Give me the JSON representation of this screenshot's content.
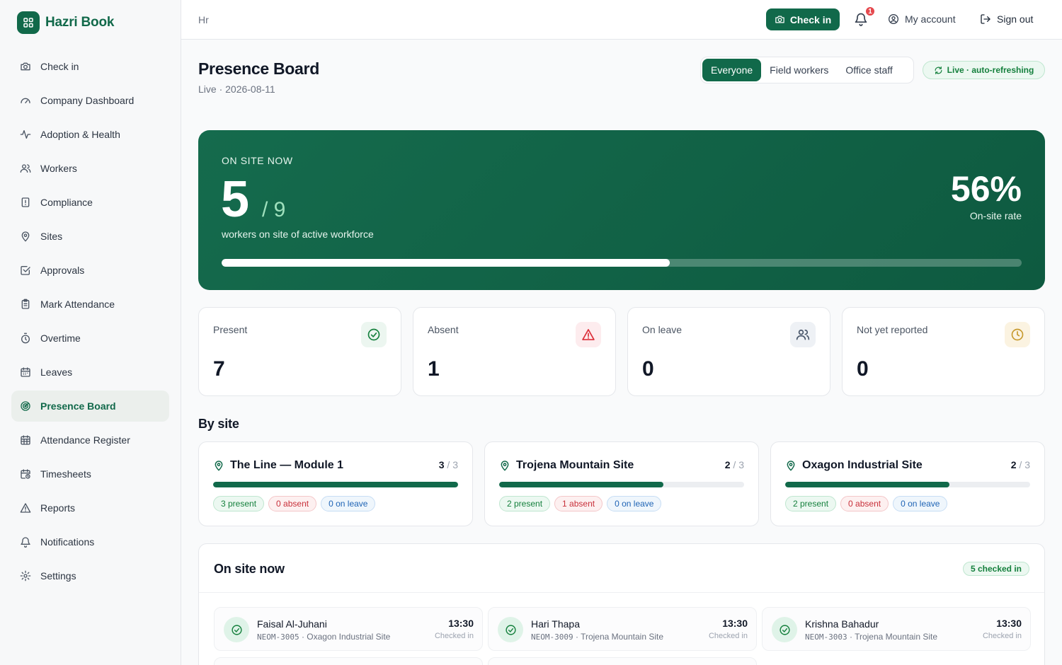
{
  "brand": {
    "name": "Hazri Book"
  },
  "sidebar": {
    "items": [
      {
        "label": "Check in",
        "icon": "camera-icon"
      },
      {
        "label": "Company Dashboard",
        "icon": "gauge-icon"
      },
      {
        "label": "Adoption & Health",
        "icon": "activity-icon"
      },
      {
        "label": "Workers",
        "icon": "users-icon"
      },
      {
        "label": "Compliance",
        "icon": "file-alert-icon"
      },
      {
        "label": "Sites",
        "icon": "map-pin-icon"
      },
      {
        "label": "Approvals",
        "icon": "check-square-icon"
      },
      {
        "label": "Mark Attendance",
        "icon": "clipboard-icon"
      },
      {
        "label": "Overtime",
        "icon": "timer-icon"
      },
      {
        "label": "Leaves",
        "icon": "calendar-icon"
      },
      {
        "label": "Presence Board",
        "icon": "radar-icon",
        "active": true
      },
      {
        "label": "Attendance Register",
        "icon": "calendar-grid-icon"
      },
      {
        "label": "Timesheets",
        "icon": "calendar-clock-icon"
      },
      {
        "label": "Reports",
        "icon": "triangle-alert-icon"
      },
      {
        "label": "Notifications",
        "icon": "bell-icon"
      },
      {
        "label": "Settings",
        "icon": "gear-icon"
      }
    ]
  },
  "topbar": {
    "breadcrumb": "Hr",
    "checkin_label": "Check in",
    "notification_count": "1",
    "account_label": "My account",
    "signout_label": "Sign out"
  },
  "header": {
    "title": "Presence Board",
    "subtitle": "Live · 2026-08-11",
    "filters": [
      "Everyone",
      "Field workers",
      "Office staff"
    ],
    "active_filter": "Everyone",
    "live_label": "Live · auto-refreshing"
  },
  "hero": {
    "label": "ON SITE NOW",
    "on_site": "5",
    "total": "/ 9",
    "caption": "workers on site of active workforce",
    "rate": "56%",
    "rate_label": "On-site rate",
    "progress": 0.56
  },
  "stats": [
    {
      "label": "Present",
      "value": "7",
      "icon": "check-circle-icon",
      "color": "#15803d",
      "bg": "#ecf6f0"
    },
    {
      "label": "Absent",
      "value": "1",
      "icon": "alert-triangle-icon",
      "color": "#dc2f3a",
      "bg": "#fdecee"
    },
    {
      "label": "On leave",
      "value": "0",
      "icon": "users-icon",
      "color": "#475569",
      "bg": "#eef1f5"
    },
    {
      "label": "Not yet reported",
      "value": "0",
      "icon": "clock-icon",
      "color": "#c79a2e",
      "bg": "#fbf3e1"
    }
  ],
  "by_site": {
    "title": "By site",
    "sites": [
      {
        "name": "The Line — Module 1",
        "present_count": "3",
        "total": "/ 3",
        "fill": 1.0,
        "present": "3 present",
        "absent": "0 absent",
        "leave": "0 on leave"
      },
      {
        "name": "Trojena Mountain Site",
        "present_count": "2",
        "total": "/ 3",
        "fill": 0.67,
        "present": "2 present",
        "absent": "1 absent",
        "leave": "0 on leave"
      },
      {
        "name": "Oxagon Industrial Site",
        "present_count": "2",
        "total": "/ 3",
        "fill": 0.67,
        "present": "2 present",
        "absent": "0 absent",
        "leave": "0 on leave"
      }
    ]
  },
  "on_site_now": {
    "title": "On site now",
    "badge": "5 checked in",
    "people": [
      {
        "name": "Faisal Al-Juhani",
        "code": "NEOM-3005",
        "site": "Oxagon Industrial Site",
        "time": "13:30",
        "status": "Checked in"
      },
      {
        "name": "Hari Thapa",
        "code": "NEOM-3009",
        "site": "Trojena Mountain Site",
        "time": "13:30",
        "status": "Checked in"
      },
      {
        "name": "Krishna Bahadur",
        "code": "NEOM-3003",
        "site": "Trojena Mountain Site",
        "time": "13:30",
        "status": "Checked in"
      }
    ]
  },
  "colors": {
    "brand": "#11694a",
    "hero": "#0e5a40",
    "present": "#15803d",
    "absent": "#c8303a",
    "leave": "#1f64b5"
  }
}
